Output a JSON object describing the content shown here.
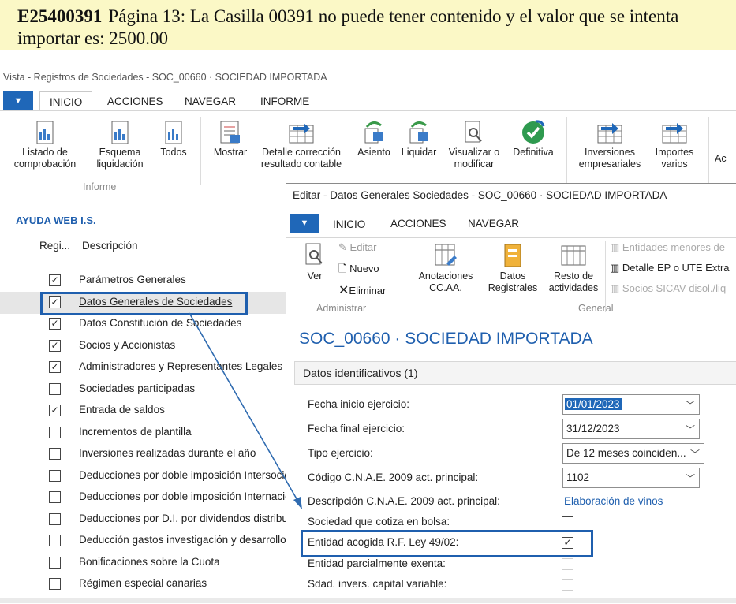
{
  "banner": {
    "code": "E25400391",
    "message": "Página 13: La Casilla 00391 no puede tener contenido y el valor que se intenta importar es: 2500.00"
  },
  "window": {
    "title": "Vista - Registros de Sociedades - SOC_00660 · SOCIEDAD IMPORTADA",
    "tabs": [
      "INICIO",
      "ACCIONES",
      "NAVEGAR",
      "INFORME"
    ]
  },
  "ribbon": {
    "informe_group": "Informe",
    "buttons": [
      {
        "label": "Listado de comprobación"
      },
      {
        "label": "Esquema liquidación"
      },
      {
        "label": "Todos"
      },
      {
        "label": "Mostrar"
      },
      {
        "label": "Detalle corrección resultado contable"
      },
      {
        "label": "Asiento"
      },
      {
        "label": "Liquidar"
      },
      {
        "label": "Visualizar o modificar"
      },
      {
        "label": "Definitiva"
      },
      {
        "label": "Inversiones empresariales"
      },
      {
        "label": "Importes varios"
      },
      {
        "label": "Ac"
      }
    ]
  },
  "help": {
    "title": "AYUDA WEB I.S.",
    "col_reg": "Regi...",
    "col_desc": "Descripción",
    "rows": [
      {
        "label": "Parámetros Generales",
        "checked": "✓"
      },
      {
        "label": "Datos Generales de Sociedades",
        "checked": "✓"
      },
      {
        "label": "Datos Constitución de Sociedades",
        "checked": "✓"
      },
      {
        "label": "Socios y Accionistas",
        "checked": "✓"
      },
      {
        "label": "Administradores y Representantes Legales",
        "checked": "✓"
      },
      {
        "label": "Sociedades participadas",
        "checked": ""
      },
      {
        "label": "Entrada de saldos",
        "checked": "✓"
      },
      {
        "label": "Incrementos de plantilla",
        "checked": ""
      },
      {
        "label": "Inversiones realizadas durante el año",
        "checked": ""
      },
      {
        "label": "Deducciones por doble imposición Intersocietaria",
        "checked": ""
      },
      {
        "label": "Deducciones por doble imposición Internacional",
        "checked": ""
      },
      {
        "label": "Deducciones por D.I. por dividendos distribuidos",
        "checked": ""
      },
      {
        "label": "Deducción gastos investigación y desarrollo",
        "checked": ""
      },
      {
        "label": "Bonificaciones sobre la Cuota",
        "checked": ""
      },
      {
        "label": "Régimen especial canarias",
        "checked": ""
      }
    ]
  },
  "modal": {
    "title": "Editar - Datos Generales Sociedades - SOC_00660 · SOCIEDAD IMPORTADA",
    "tabs": [
      "INICIO",
      "ACCIONES",
      "NAVEGAR"
    ],
    "ribbon": {
      "ver": "Ver",
      "editar": "Editar",
      "nuevo": "Nuevo",
      "eliminar": "Eliminar",
      "administrar": "Administrar",
      "anotaciones": "Anotaciones CC.AA.",
      "datos_registrales": "Datos Registrales",
      "resto_actividades": "Resto de actividades",
      "general": "General",
      "entidades_menores": "Entidades menores de",
      "detalle_ep": "Detalle EP o UTE Extra",
      "socios_sicav": "Socios SICAV disol./liq"
    },
    "header": "SOC_00660 · SOCIEDAD IMPORTADA",
    "section": "Datos identificativos (1)",
    "fields": {
      "fecha_inicio_label": "Fecha inicio ejercicio:",
      "fecha_inicio_value": "01/01/2023",
      "fecha_final_label": "Fecha final ejercicio:",
      "fecha_final_value": "31/12/2023",
      "tipo_label": "Tipo ejercicio:",
      "tipo_value": "De 12 meses coinciden...",
      "cnae_label": "Código C.N.A.E. 2009 act. principal:",
      "cnae_value": "1102",
      "desc_label": "Descripción C.N.A.E. 2009 act. principal:",
      "desc_value": "Elaboración de vinos",
      "bolsa_label": "Sociedad que cotiza en bolsa:",
      "acogida_label": "Entidad acogida R.F. Ley 49/02:",
      "acogida_value": "✓",
      "exenta_label": "Entidad parcialmente exenta:",
      "sicav_label": "Sdad. invers. capital variable:"
    }
  }
}
